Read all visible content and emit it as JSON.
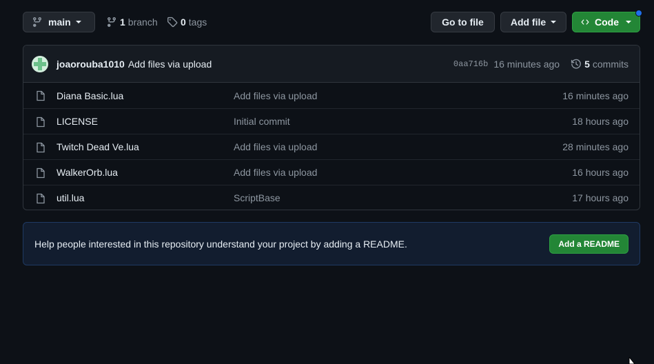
{
  "toolbar": {
    "branch_label": "main",
    "branch_count": "1",
    "branch_word": "branch",
    "tag_count": "0",
    "tag_word": "tags",
    "go_to_file": "Go to file",
    "add_file": "Add file",
    "code": "Code"
  },
  "commit": {
    "author": "joaorouba1010",
    "message": "Add files via upload",
    "sha": "0aa716b",
    "time": "16 minutes ago",
    "commit_count": "5",
    "commit_word": "commits"
  },
  "files": [
    {
      "name": "Diana Basic.lua",
      "message": "Add files via upload",
      "age": "16 minutes ago"
    },
    {
      "name": "LICENSE",
      "message": "Initial commit",
      "age": "18 hours ago"
    },
    {
      "name": "Twitch Dead Ve.lua",
      "message": "Add files via upload",
      "age": "28 minutes ago"
    },
    {
      "name": "WalkerOrb.lua",
      "message": "Add files via upload",
      "age": "16 hours ago"
    },
    {
      "name": "util.lua",
      "message": "ScriptBase",
      "age": "17 hours ago"
    }
  ],
  "readme": {
    "text": "Help people interested in this repository understand your project by adding a README.",
    "button": "Add a README"
  },
  "colors": {
    "background": "#0d1117",
    "code_button": "#238636",
    "notification_dot": "#1f6feb",
    "readme_banner": "#121d2f"
  }
}
